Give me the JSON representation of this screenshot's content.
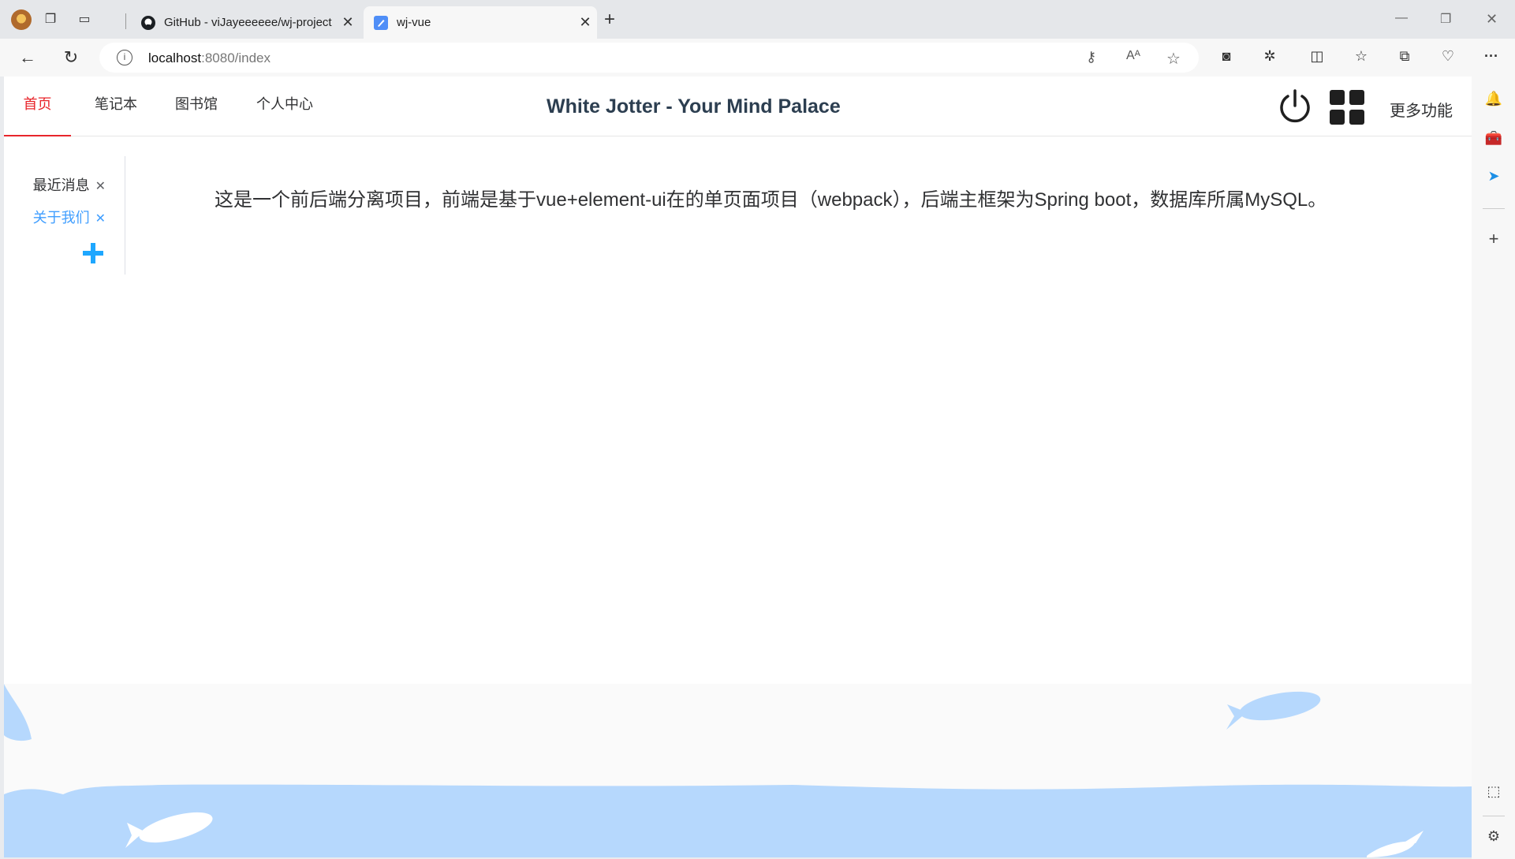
{
  "browser": {
    "tabs": [
      {
        "title": "GitHub - viJayeeeeee/wj-project",
        "active": false
      },
      {
        "title": "wj-vue",
        "active": true
      }
    ],
    "address": {
      "host": "localhost",
      "path": ":8080/index"
    }
  },
  "nav": {
    "items": [
      "首页",
      "笔记本",
      "图书馆",
      "个人中心"
    ],
    "active_index": 0
  },
  "header": {
    "title": "White Jotter - Your Mind Palace",
    "more_label": "更多功能"
  },
  "sidebar": {
    "tabs": [
      {
        "label": "最近消息",
        "active": false
      },
      {
        "label": "关于我们",
        "active": true
      }
    ]
  },
  "main": {
    "description": "这是一个前后端分离项目，前端是基于vue+element-ui在的单页面项目（webpack），后端主框架为Spring boot，数据库所属MySQL。"
  },
  "colors": {
    "accent_red": "#e8252b",
    "accent_blue": "#409eff",
    "plus_blue": "#1ea7ff",
    "wave_blue": "#b6d8fd"
  },
  "icons": [
    "profile-icon",
    "workspaces-icon",
    "tab-actions-icon",
    "github-icon",
    "wj-vue-favicon",
    "back-icon",
    "refresh-icon",
    "info-icon",
    "key-icon",
    "read-aloud-icon",
    "favorite-star-icon",
    "power-icon",
    "grid-icon",
    "bell-icon",
    "toolbox-icon",
    "send-icon",
    "screenshot-icon",
    "settings-icon"
  ]
}
